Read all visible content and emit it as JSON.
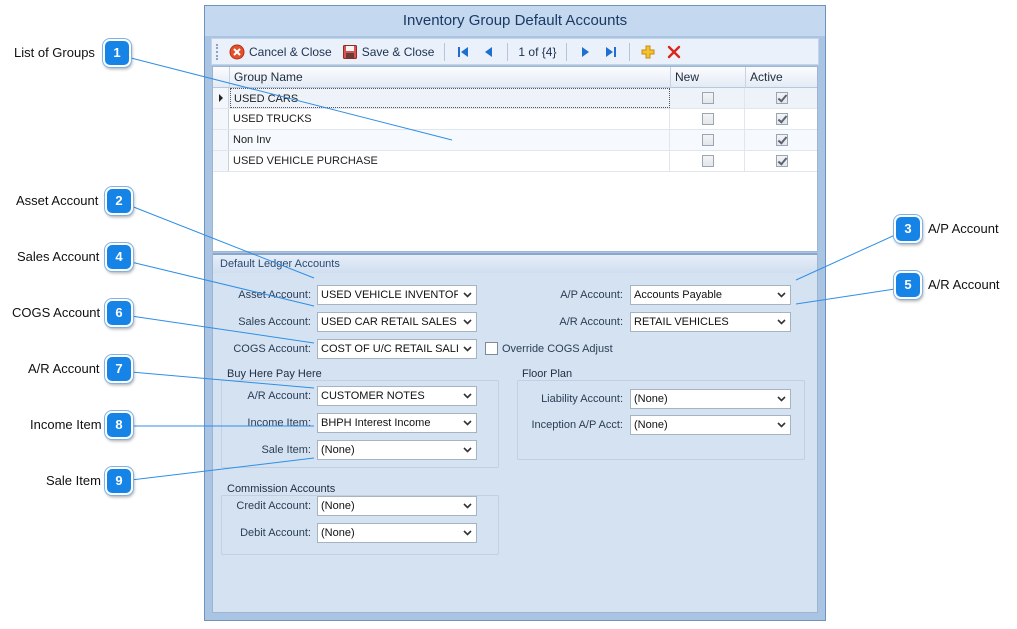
{
  "window": {
    "title": "Inventory Group Default Accounts"
  },
  "toolbar": {
    "cancel_label": "Cancel & Close",
    "save_label": "Save & Close",
    "record_position": "1 of {4}"
  },
  "grid": {
    "columns": [
      "Group Name",
      "New",
      "Active"
    ],
    "rows": [
      {
        "name": "USED CARS",
        "new": false,
        "active": true
      },
      {
        "name": "USED TRUCKS",
        "new": false,
        "active": true
      },
      {
        "name": "Non Inv",
        "new": false,
        "active": true
      },
      {
        "name": "USED VEHICLE PURCHASE",
        "new": false,
        "active": true
      }
    ]
  },
  "ledger": {
    "title": "Default Ledger Accounts",
    "asset_label": "Asset Account:",
    "asset_value": "USED VEHICLE INVENTOR",
    "sales_label": "Sales Account:",
    "sales_value": "USED CAR RETAIL SALES",
    "cogs_label": "COGS Account:",
    "cogs_value": "COST OF U/C RETAIL SALI",
    "override_cogs_label": "Override COGS Adjust",
    "override_cogs_checked": false,
    "ap_label": "A/P Account:",
    "ap_value": "Accounts Payable",
    "ar_label": "A/R Account:",
    "ar_value": "RETAIL VEHICLES"
  },
  "bhph": {
    "title": "Buy Here Pay Here",
    "ar_label": "A/R Account:",
    "ar_value": "CUSTOMER NOTES",
    "income_label": "Income Item:",
    "income_value": "BHPH Interest Income",
    "sale_label": "Sale Item:",
    "sale_value": "(None)"
  },
  "commission": {
    "title": "Commission Accounts",
    "credit_label": "Credit Account:",
    "credit_value": "(None)",
    "debit_label": "Debit Account:",
    "debit_value": "(None)"
  },
  "floor_plan": {
    "title": "Floor Plan",
    "liability_label": "Liability Account:",
    "liability_value": "(None)",
    "inception_label": "Inception A/P Acct:",
    "inception_value": "(None)"
  },
  "callouts": [
    {
      "num": "1",
      "label": "List of Groups"
    },
    {
      "num": "2",
      "label": "Asset Account"
    },
    {
      "num": "3",
      "label": "A/P Account"
    },
    {
      "num": "4",
      "label": "Sales Account"
    },
    {
      "num": "5",
      "label": "A/R Account"
    },
    {
      "num": "6",
      "label": "COGS Account"
    },
    {
      "num": "7",
      "label": "A/R Account"
    },
    {
      "num": "8",
      "label": "Income Item"
    },
    {
      "num": "9",
      "label": "Sale Item"
    }
  ],
  "colors": {
    "callout_blue": "#1683e6",
    "window_bg": "#aac5e4",
    "panel_bg": "#d5e2f2",
    "title_text": "#1b3a64",
    "delete_red": "#d9261c",
    "add_orange": "#e8a317"
  },
  "icons": [
    "cancel-icon",
    "save-icon",
    "first-record-icon",
    "previous-record-icon",
    "next-record-icon",
    "last-record-icon",
    "add-icon",
    "delete-icon",
    "chevron-down-icon",
    "row-indicator-icon",
    "checkmark-icon"
  ]
}
